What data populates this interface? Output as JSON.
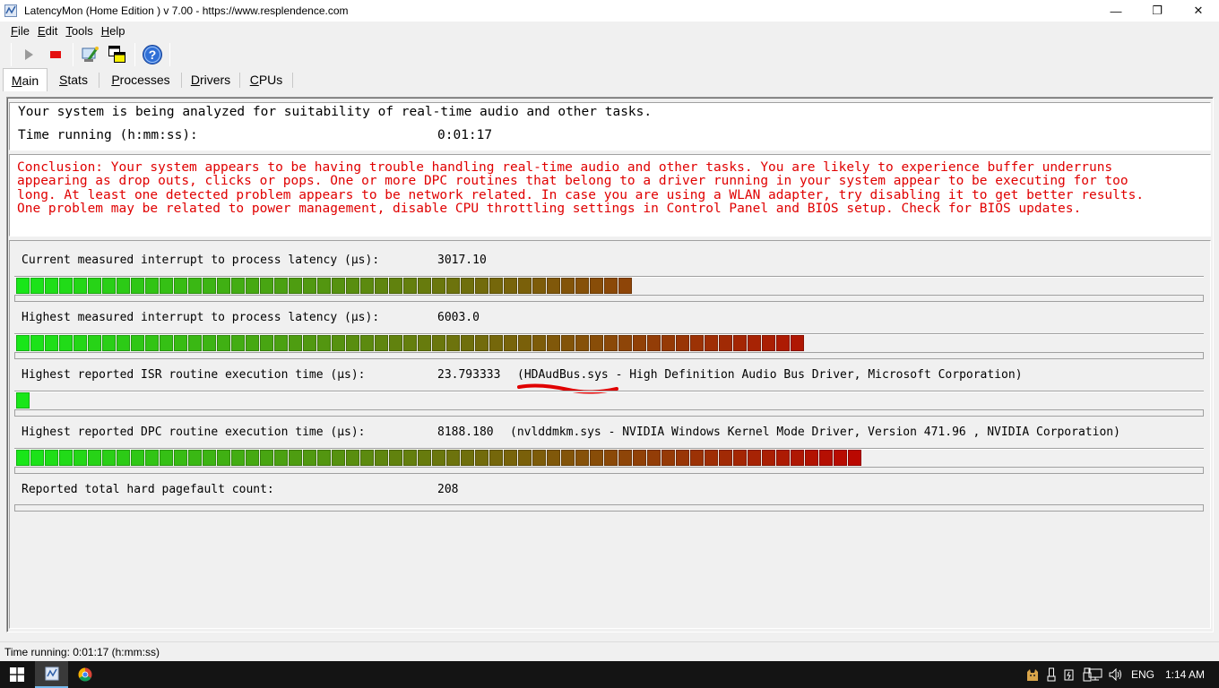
{
  "window": {
    "title": "LatencyMon  (Home Edition )  v 7.00 - https://www.resplendence.com",
    "minimize_glyph": "—",
    "restore_glyph": "❐",
    "close_glyph": "✕"
  },
  "menu": {
    "file": {
      "u": "F",
      "rest": "ile"
    },
    "edit": {
      "u": "E",
      "rest": "dit"
    },
    "tools": {
      "u": "T",
      "rest": "ools"
    },
    "help": {
      "u": "H",
      "rest": "elp"
    }
  },
  "toolbar": {
    "icons": [
      "play-icon",
      "stop-icon",
      "wizard-icon",
      "windows-icon",
      "help-icon"
    ],
    "help_glyph": "?"
  },
  "tabs": {
    "main": {
      "u": "M",
      "rest": "ain"
    },
    "stats": {
      "u": "S",
      "rest": "tats"
    },
    "processes": {
      "u": "P",
      "rest": "rocesses"
    },
    "drivers": {
      "u": "D",
      "rest": "rivers"
    },
    "cpus": {
      "u": "C",
      "rest": "PUs"
    },
    "active": "main"
  },
  "info": {
    "analyzing": "Your system is being analyzed for suitability of real-time audio and other tasks.",
    "time_label": "Time running (h:mm:ss):",
    "time_value": "0:01:17"
  },
  "conclusion": {
    "line1": "Conclusion: Your system appears to be having trouble handling real-time audio and other tasks. You are likely to experience buffer underruns",
    "line2": "appearing as drop outs, clicks or pops. One or more DPC routines that belong to a driver running in your system appear to be executing for too",
    "line3": "long. At least one detected problem appears to be network related. In case you are using a WLAN adapter, try disabling it to get better results.",
    "line4": "One problem may be related to power management, disable CPU throttling settings in Control Panel and BIOS setup. Check for BIOS updates.",
    "color": "#e00000"
  },
  "metrics": {
    "current_latency": {
      "label": "Current measured interrupt to process latency (µs):",
      "value": "3017.10",
      "detail": "",
      "meter_fraction": 0.52
    },
    "highest_latency": {
      "label": "Highest measured interrupt to process latency (µs):",
      "value": "6003.0",
      "detail": "",
      "meter_fraction": 0.665
    },
    "highest_isr": {
      "label": "Highest reported ISR routine execution time (µs):",
      "value": "23.793333",
      "detail": "(HDAudBus.sys - High Definition Audio Bus Driver, Microsoft Corporation)",
      "meter_fraction": 0.011
    },
    "highest_dpc": {
      "label": "Highest reported DPC routine execution time (µs):",
      "value": "8188.180",
      "detail": "(nvlddmkm.sys - NVIDIA Windows Kernel Mode Driver, Version 471.96 , NVIDIA Corporation)",
      "meter_fraction": 0.725
    },
    "pagefault": {
      "label": "Reported total hard pagefault count:",
      "value": "208",
      "detail": ""
    }
  },
  "status_bar": {
    "text": "Time running: 0:01:17  (h:mm:ss)"
  },
  "taskbar": {
    "language": "ENG",
    "clock": "1:14 AM",
    "apps": [
      "latencymon-taskbar-icon",
      "chrome-taskbar-icon"
    ]
  },
  "colors": {
    "meter_green": "#19e619",
    "meter_red": "#c00000",
    "annotation_red": "#e00000",
    "taskbar_bg": "#141414"
  }
}
